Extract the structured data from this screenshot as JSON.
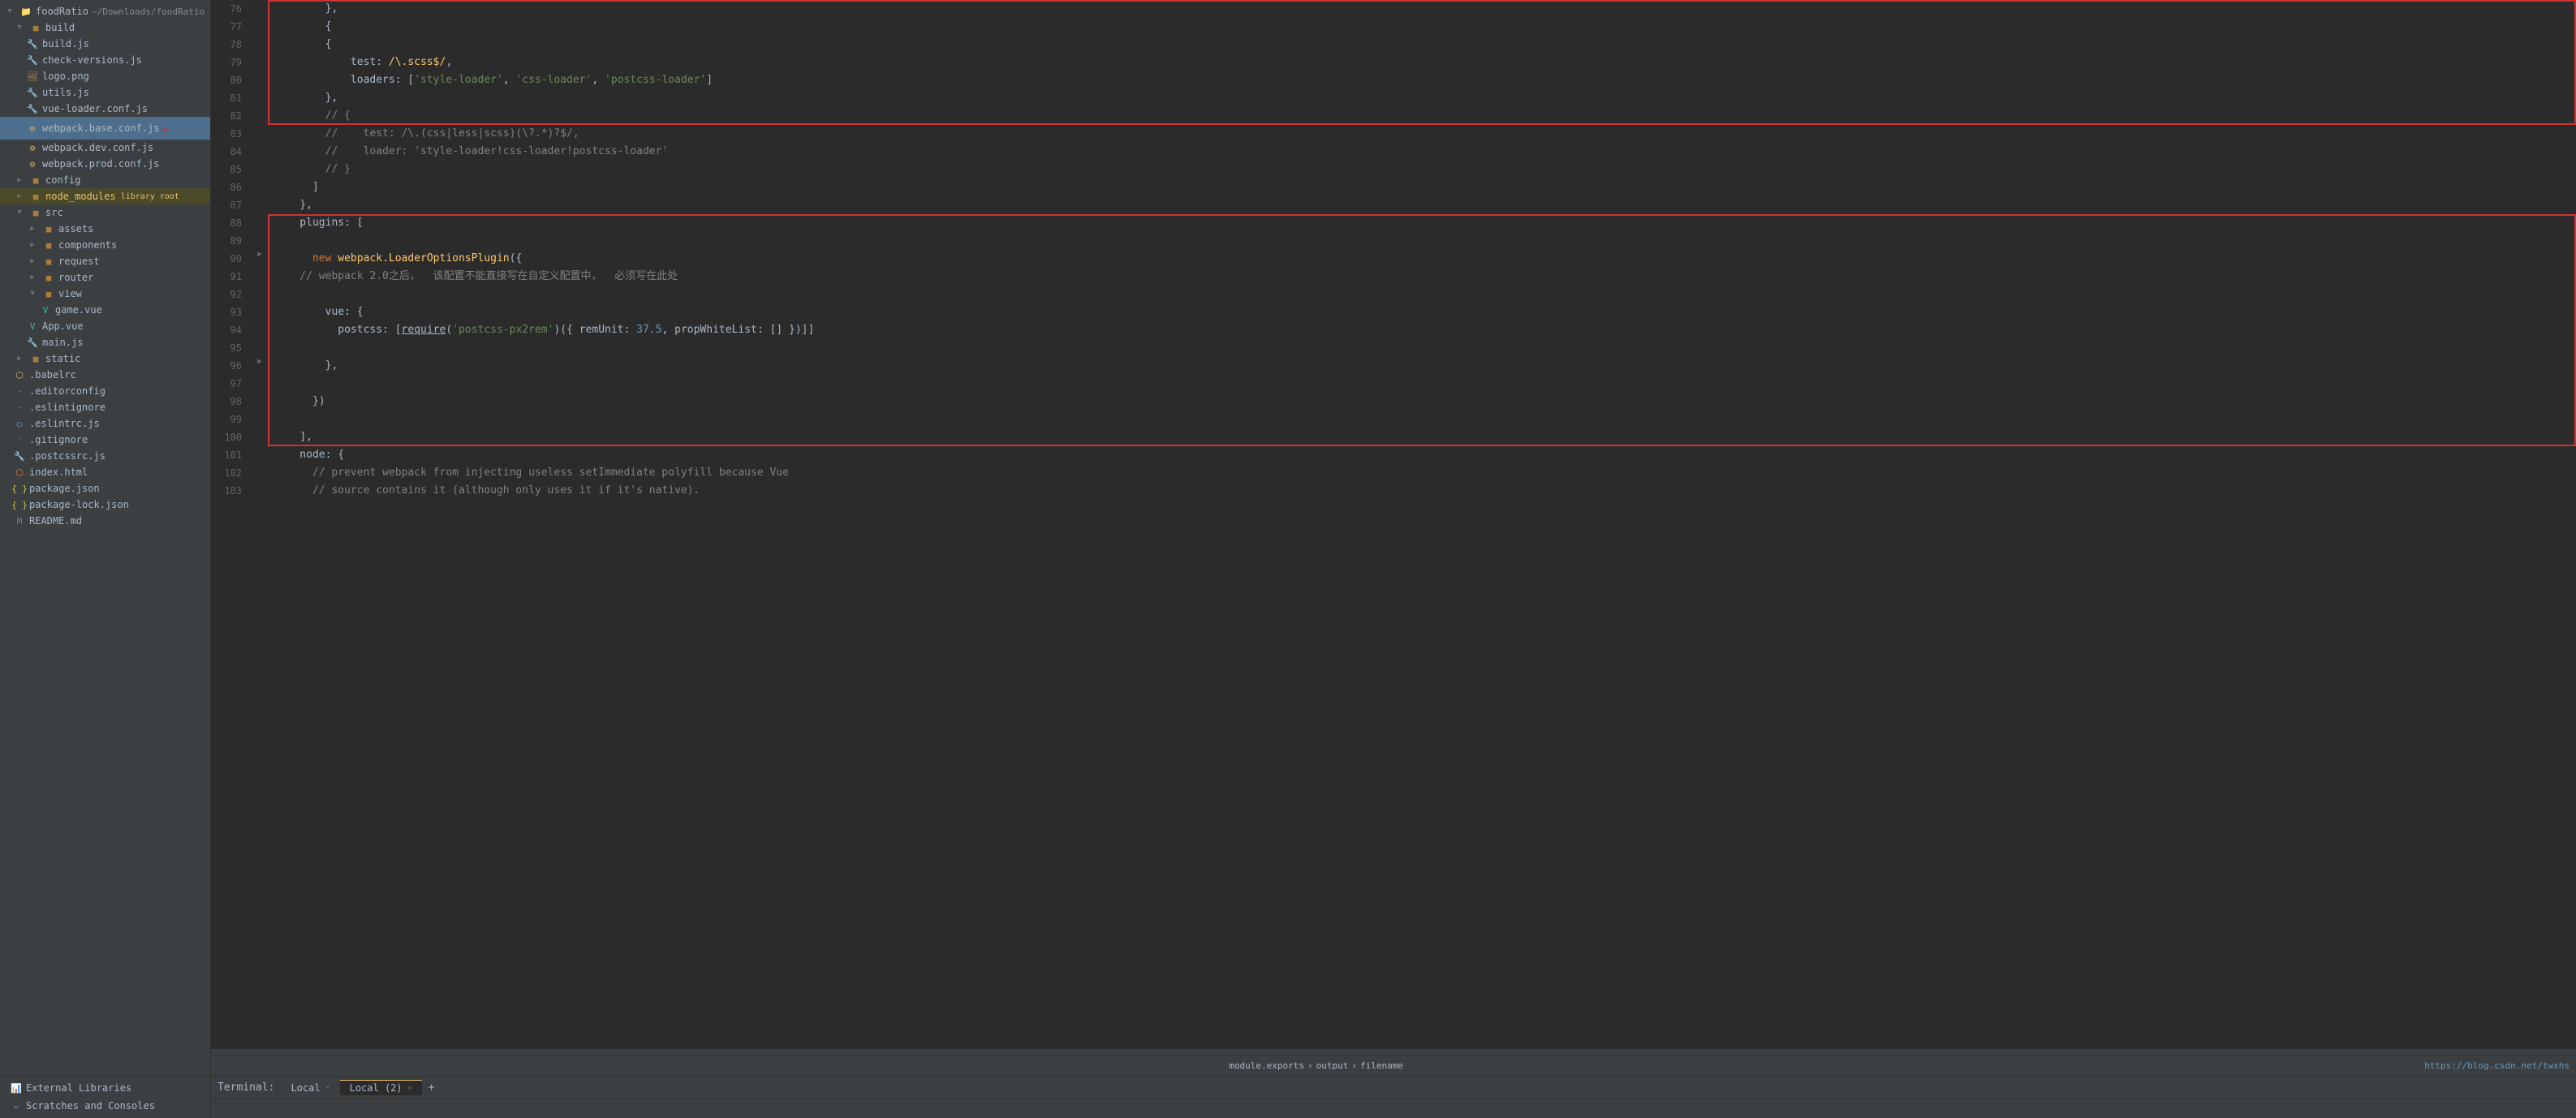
{
  "app": {
    "title": "foodRatio"
  },
  "sidebar": {
    "root_label": "foodRatio",
    "root_path": "~/Downloads/foodRatio",
    "items": [
      {
        "id": "build-folder",
        "label": "build",
        "type": "folder-open",
        "indent": 1,
        "expanded": true
      },
      {
        "id": "build-js",
        "label": "build.js",
        "type": "js",
        "indent": 2
      },
      {
        "id": "check-versions-js",
        "label": "check-versions.js",
        "type": "js",
        "indent": 2
      },
      {
        "id": "logo-png",
        "label": "logo.png",
        "type": "png",
        "indent": 2
      },
      {
        "id": "utils-js",
        "label": "utils.js",
        "type": "js",
        "indent": 2
      },
      {
        "id": "vue-loader-conf-js",
        "label": "vue-loader.conf.js",
        "type": "js",
        "indent": 2
      },
      {
        "id": "webpack-base-conf-js",
        "label": "webpack.base.conf.js",
        "type": "config",
        "indent": 2,
        "selected": true
      },
      {
        "id": "webpack-dev-conf-js",
        "label": "webpack.dev.conf.js",
        "type": "config",
        "indent": 2
      },
      {
        "id": "webpack-prod-conf-js",
        "label": "webpack.prod.conf.js",
        "type": "config",
        "indent": 2
      },
      {
        "id": "config-folder",
        "label": "config",
        "type": "folder",
        "indent": 1
      },
      {
        "id": "node-modules-folder",
        "label": "node_modules",
        "type": "folder",
        "indent": 1,
        "badge": "library root",
        "special": "node_modules"
      },
      {
        "id": "src-folder",
        "label": "src",
        "type": "folder-open",
        "indent": 1,
        "expanded": true
      },
      {
        "id": "assets-folder",
        "label": "assets",
        "type": "folder",
        "indent": 2
      },
      {
        "id": "components-folder",
        "label": "components",
        "type": "folder",
        "indent": 2
      },
      {
        "id": "request-folder",
        "label": "request",
        "type": "folder",
        "indent": 2
      },
      {
        "id": "router-folder",
        "label": "router",
        "type": "folder",
        "indent": 2
      },
      {
        "id": "view-folder",
        "label": "view",
        "type": "folder-open",
        "indent": 2,
        "expanded": true
      },
      {
        "id": "game-vue",
        "label": "game.vue",
        "type": "vue",
        "indent": 3
      },
      {
        "id": "app-vue",
        "label": "App.vue",
        "type": "vue",
        "indent": 2
      },
      {
        "id": "main-js",
        "label": "main.js",
        "type": "js",
        "indent": 2
      },
      {
        "id": "static-folder",
        "label": "static",
        "type": "folder",
        "indent": 1
      },
      {
        "id": "babelrc",
        "label": ".babelrc",
        "type": "dot",
        "indent": 1
      },
      {
        "id": "editorconfig",
        "label": ".editorconfig",
        "type": "dot",
        "indent": 1
      },
      {
        "id": "eslintignore",
        "label": ".eslintignore",
        "type": "dot",
        "indent": 1
      },
      {
        "id": "eslintrc-js",
        "label": ".eslintrc.js",
        "type": "dot-js",
        "indent": 1
      },
      {
        "id": "gitignore",
        "label": ".gitignore",
        "type": "dot",
        "indent": 1
      },
      {
        "id": "postcssrc-js",
        "label": ".postcssrc.js",
        "type": "js",
        "indent": 1
      },
      {
        "id": "index-html",
        "label": "index.html",
        "type": "html",
        "indent": 1
      },
      {
        "id": "package-json",
        "label": "package.json",
        "type": "json",
        "indent": 1
      },
      {
        "id": "package-lock-json",
        "label": "package-lock.json",
        "type": "json",
        "indent": 1
      },
      {
        "id": "readme-md",
        "label": "README.md",
        "type": "md",
        "indent": 1
      }
    ],
    "external_libraries": "External Libraries",
    "scratches": "Scratches and Consoles"
  },
  "editor": {
    "lines": [
      {
        "num": 76,
        "gutter": "",
        "code": "        },",
        "highlight": "box1"
      },
      {
        "num": 77,
        "gutter": "",
        "code": "        {",
        "highlight": "box1"
      },
      {
        "num": 78,
        "gutter": "",
        "code": "        {",
        "highlight": "box1"
      },
      {
        "num": 79,
        "gutter": "",
        "code": "            test: /\\.scss$/,",
        "highlight": "box1",
        "tokens": [
          {
            "text": "            test: ",
            "class": "syn-white"
          },
          {
            "text": "/\\.scss$/",
            "class": "syn-regex"
          },
          {
            "text": ",",
            "class": "syn-white"
          }
        ]
      },
      {
        "num": 80,
        "gutter": "",
        "code": "            loaders: ['style-loader', 'css-loader', 'postcss-loader']",
        "highlight": "box1",
        "tokens": [
          {
            "text": "            loaders: [",
            "class": "syn-white"
          },
          {
            "text": "'style-loader'",
            "class": "syn-str"
          },
          {
            "text": ", ",
            "class": "syn-white"
          },
          {
            "text": "'css-loader'",
            "class": "syn-str"
          },
          {
            "text": ", ",
            "class": "syn-white"
          },
          {
            "text": "'postcss-loader'",
            "class": "syn-str"
          },
          {
            "text": "]",
            "class": "syn-white"
          }
        ]
      },
      {
        "num": 81,
        "gutter": "",
        "code": "        },",
        "highlight": "box1"
      },
      {
        "num": 82,
        "gutter": "",
        "code": "        // {",
        "highlight": "box1",
        "comment": true
      },
      {
        "num": 83,
        "gutter": "",
        "code": "        //    test: /\\.(css|less|scss)(\\?.*)?$/,",
        "highlight": "none",
        "comment": true
      },
      {
        "num": 84,
        "gutter": "",
        "code": "        //    loader: 'style-loader!css-loader!postcss-loader'",
        "highlight": "none",
        "comment": true
      },
      {
        "num": 85,
        "gutter": "",
        "code": "        // }",
        "highlight": "none",
        "comment": true
      },
      {
        "num": 86,
        "gutter": "",
        "code": "      ]",
        "highlight": "none"
      },
      {
        "num": 87,
        "gutter": "",
        "code": "    },",
        "highlight": "none"
      },
      {
        "num": 88,
        "gutter": "",
        "code": "    plugins: [",
        "highlight": "box2",
        "tokens": [
          {
            "text": "    plugins: [",
            "class": "syn-white"
          }
        ]
      },
      {
        "num": 89,
        "gutter": "",
        "code": "",
        "highlight": "box2"
      },
      {
        "num": 90,
        "gutter": "▶",
        "code": "      new webpack.LoaderOptionsPlugin({",
        "highlight": "box2",
        "tokens": [
          {
            "text": "      ",
            "class": "syn-white"
          },
          {
            "text": "new ",
            "class": "syn-key"
          },
          {
            "text": "webpack.LoaderOptionsPlugin",
            "class": "syn-orange"
          },
          {
            "text": "({",
            "class": "syn-white"
          }
        ]
      },
      {
        "num": 91,
        "gutter": "",
        "code": "    // webpack 2.0之后，  该配置不能直接写在自定义配置中，  必须写在此处",
        "highlight": "box2",
        "comment": true
      },
      {
        "num": 92,
        "gutter": "",
        "code": "",
        "highlight": "box2"
      },
      {
        "num": 93,
        "gutter": "",
        "code": "        vue: {",
        "highlight": "box2",
        "tokens": [
          {
            "text": "        vue: {",
            "class": "syn-white"
          }
        ]
      },
      {
        "num": 94,
        "gutter": "",
        "code": "          postcss: [require('postcss-px2rem')({ remUnit: 37.5, propWhiteList: [] })]]",
        "highlight": "box2",
        "tokens": [
          {
            "text": "          postcss: [",
            "class": "syn-white"
          },
          {
            "text": "require",
            "class": "syn-underline syn-white"
          },
          {
            "text": "(",
            "class": "syn-white"
          },
          {
            "text": "'postcss-px2rem'",
            "class": "syn-str"
          },
          {
            "text": ")({ remUnit: ",
            "class": "syn-white"
          },
          {
            "text": "37.5",
            "class": "syn-num"
          },
          {
            "text": ", propWhiteList: [] })]]",
            "class": "syn-white"
          }
        ]
      },
      {
        "num": 95,
        "gutter": "",
        "code": "",
        "highlight": "box2"
      },
      {
        "num": 96,
        "gutter": "▶",
        "code": "        },",
        "highlight": "box2"
      },
      {
        "num": 97,
        "gutter": "",
        "code": "",
        "highlight": "box2"
      },
      {
        "num": 98,
        "gutter": "",
        "code": "      })",
        "highlight": "box2"
      },
      {
        "num": 99,
        "gutter": "",
        "code": "",
        "highlight": "box2"
      },
      {
        "num": 100,
        "gutter": "",
        "code": "    ],",
        "highlight": "box2"
      },
      {
        "num": 101,
        "gutter": "",
        "code": "    node: {",
        "highlight": "none"
      },
      {
        "num": 102,
        "gutter": "",
        "code": "      // prevent webpack from injecting useless setImmediate polyfill because Vue",
        "highlight": "none",
        "comment": true
      },
      {
        "num": 103,
        "gutter": "",
        "code": "      // source contains it (although only uses it if it's native).",
        "highlight": "none",
        "comment": true
      }
    ]
  },
  "statusbar": {
    "breadcrumb": [
      "module.exports",
      "output",
      "filename"
    ],
    "right_url": "https://blog.csdn.net/twxhs"
  },
  "terminal": {
    "label": "Terminal:",
    "tabs": [
      {
        "label": "Local",
        "closable": true,
        "active": false
      },
      {
        "label": "Local (2)",
        "closable": true,
        "active": false
      }
    ],
    "add_label": "+"
  }
}
